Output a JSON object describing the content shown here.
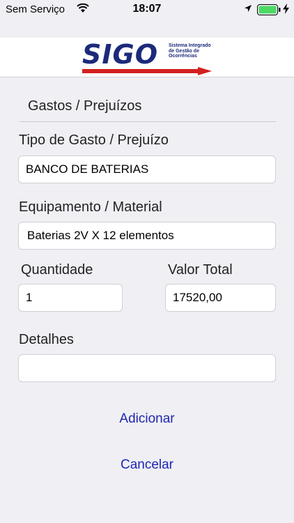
{
  "status_bar": {
    "carrier": "Sem Serviço",
    "time": "18:07"
  },
  "header": {
    "logo_text": "SIGO",
    "logo_tagline": "Sistema Integrado de Gestão de Ocorrências",
    "brand_colors": {
      "primary": "#1b2a7a",
      "accent": "#d42020"
    }
  },
  "form": {
    "section_title": "Gastos / Prejuízos",
    "tipo_label": "Tipo de Gasto / Prejuízo",
    "tipo_value": "BANCO DE BATERIAS",
    "equipamento_label": "Equipamento / Material",
    "equipamento_value": "Baterias 2V X 12 elementos",
    "quantidade_label": "Quantidade",
    "quantidade_value": "1",
    "valor_label": "Valor Total",
    "valor_value": "17520,00",
    "detalhes_label": "Detalhes",
    "detalhes_value": ""
  },
  "actions": {
    "add_label": "Adicionar",
    "cancel_label": "Cancelar",
    "link_color": "#1f25b0"
  }
}
